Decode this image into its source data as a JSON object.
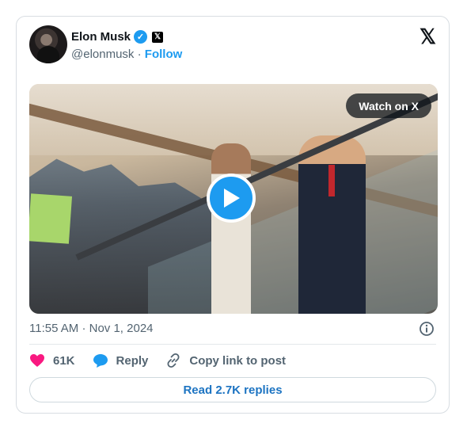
{
  "author": {
    "name": "Elon Musk",
    "handle": "@elonmusk",
    "separator": "·",
    "follow_label": "Follow",
    "verified_icon": "verified-badge-icon",
    "affiliate_icon": "x-affiliate-icon"
  },
  "platform_icon": "x-logo-icon",
  "media": {
    "watch_label": "Watch on X",
    "play_icon": "play-icon"
  },
  "timestamp": {
    "time": "11:55 AM",
    "separator": "·",
    "date": "Nov 1, 2024"
  },
  "actions": {
    "likes": "61K",
    "reply_label": "Reply",
    "copy_label": "Copy link to post"
  },
  "read_replies_label": "Read 2.7K replies",
  "colors": {
    "accent": "#1d9bf0",
    "like": "#f91880",
    "muted": "#536471"
  }
}
